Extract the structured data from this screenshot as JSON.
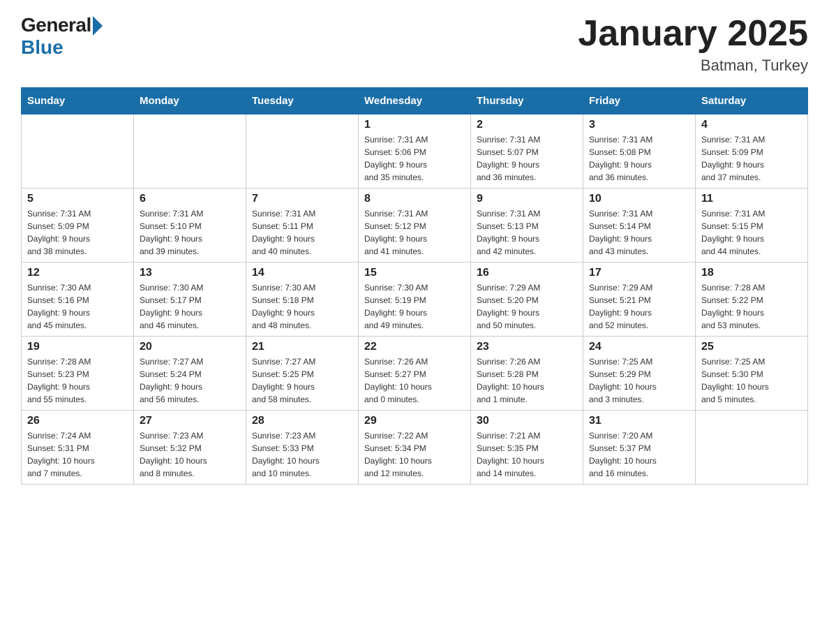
{
  "logo": {
    "general": "General",
    "blue": "Blue"
  },
  "title": "January 2025",
  "location": "Batman, Turkey",
  "days_of_week": [
    "Sunday",
    "Monday",
    "Tuesday",
    "Wednesday",
    "Thursday",
    "Friday",
    "Saturday"
  ],
  "weeks": [
    [
      {
        "day": "",
        "info": ""
      },
      {
        "day": "",
        "info": ""
      },
      {
        "day": "",
        "info": ""
      },
      {
        "day": "1",
        "info": "Sunrise: 7:31 AM\nSunset: 5:06 PM\nDaylight: 9 hours\nand 35 minutes."
      },
      {
        "day": "2",
        "info": "Sunrise: 7:31 AM\nSunset: 5:07 PM\nDaylight: 9 hours\nand 36 minutes."
      },
      {
        "day": "3",
        "info": "Sunrise: 7:31 AM\nSunset: 5:08 PM\nDaylight: 9 hours\nand 36 minutes."
      },
      {
        "day": "4",
        "info": "Sunrise: 7:31 AM\nSunset: 5:09 PM\nDaylight: 9 hours\nand 37 minutes."
      }
    ],
    [
      {
        "day": "5",
        "info": "Sunrise: 7:31 AM\nSunset: 5:09 PM\nDaylight: 9 hours\nand 38 minutes."
      },
      {
        "day": "6",
        "info": "Sunrise: 7:31 AM\nSunset: 5:10 PM\nDaylight: 9 hours\nand 39 minutes."
      },
      {
        "day": "7",
        "info": "Sunrise: 7:31 AM\nSunset: 5:11 PM\nDaylight: 9 hours\nand 40 minutes."
      },
      {
        "day": "8",
        "info": "Sunrise: 7:31 AM\nSunset: 5:12 PM\nDaylight: 9 hours\nand 41 minutes."
      },
      {
        "day": "9",
        "info": "Sunrise: 7:31 AM\nSunset: 5:13 PM\nDaylight: 9 hours\nand 42 minutes."
      },
      {
        "day": "10",
        "info": "Sunrise: 7:31 AM\nSunset: 5:14 PM\nDaylight: 9 hours\nand 43 minutes."
      },
      {
        "day": "11",
        "info": "Sunrise: 7:31 AM\nSunset: 5:15 PM\nDaylight: 9 hours\nand 44 minutes."
      }
    ],
    [
      {
        "day": "12",
        "info": "Sunrise: 7:30 AM\nSunset: 5:16 PM\nDaylight: 9 hours\nand 45 minutes."
      },
      {
        "day": "13",
        "info": "Sunrise: 7:30 AM\nSunset: 5:17 PM\nDaylight: 9 hours\nand 46 minutes."
      },
      {
        "day": "14",
        "info": "Sunrise: 7:30 AM\nSunset: 5:18 PM\nDaylight: 9 hours\nand 48 minutes."
      },
      {
        "day": "15",
        "info": "Sunrise: 7:30 AM\nSunset: 5:19 PM\nDaylight: 9 hours\nand 49 minutes."
      },
      {
        "day": "16",
        "info": "Sunrise: 7:29 AM\nSunset: 5:20 PM\nDaylight: 9 hours\nand 50 minutes."
      },
      {
        "day": "17",
        "info": "Sunrise: 7:29 AM\nSunset: 5:21 PM\nDaylight: 9 hours\nand 52 minutes."
      },
      {
        "day": "18",
        "info": "Sunrise: 7:28 AM\nSunset: 5:22 PM\nDaylight: 9 hours\nand 53 minutes."
      }
    ],
    [
      {
        "day": "19",
        "info": "Sunrise: 7:28 AM\nSunset: 5:23 PM\nDaylight: 9 hours\nand 55 minutes."
      },
      {
        "day": "20",
        "info": "Sunrise: 7:27 AM\nSunset: 5:24 PM\nDaylight: 9 hours\nand 56 minutes."
      },
      {
        "day": "21",
        "info": "Sunrise: 7:27 AM\nSunset: 5:25 PM\nDaylight: 9 hours\nand 58 minutes."
      },
      {
        "day": "22",
        "info": "Sunrise: 7:26 AM\nSunset: 5:27 PM\nDaylight: 10 hours\nand 0 minutes."
      },
      {
        "day": "23",
        "info": "Sunrise: 7:26 AM\nSunset: 5:28 PM\nDaylight: 10 hours\nand 1 minute."
      },
      {
        "day": "24",
        "info": "Sunrise: 7:25 AM\nSunset: 5:29 PM\nDaylight: 10 hours\nand 3 minutes."
      },
      {
        "day": "25",
        "info": "Sunrise: 7:25 AM\nSunset: 5:30 PM\nDaylight: 10 hours\nand 5 minutes."
      }
    ],
    [
      {
        "day": "26",
        "info": "Sunrise: 7:24 AM\nSunset: 5:31 PM\nDaylight: 10 hours\nand 7 minutes."
      },
      {
        "day": "27",
        "info": "Sunrise: 7:23 AM\nSunset: 5:32 PM\nDaylight: 10 hours\nand 8 minutes."
      },
      {
        "day": "28",
        "info": "Sunrise: 7:23 AM\nSunset: 5:33 PM\nDaylight: 10 hours\nand 10 minutes."
      },
      {
        "day": "29",
        "info": "Sunrise: 7:22 AM\nSunset: 5:34 PM\nDaylight: 10 hours\nand 12 minutes."
      },
      {
        "day": "30",
        "info": "Sunrise: 7:21 AM\nSunset: 5:35 PM\nDaylight: 10 hours\nand 14 minutes."
      },
      {
        "day": "31",
        "info": "Sunrise: 7:20 AM\nSunset: 5:37 PM\nDaylight: 10 hours\nand 16 minutes."
      },
      {
        "day": "",
        "info": ""
      }
    ]
  ]
}
